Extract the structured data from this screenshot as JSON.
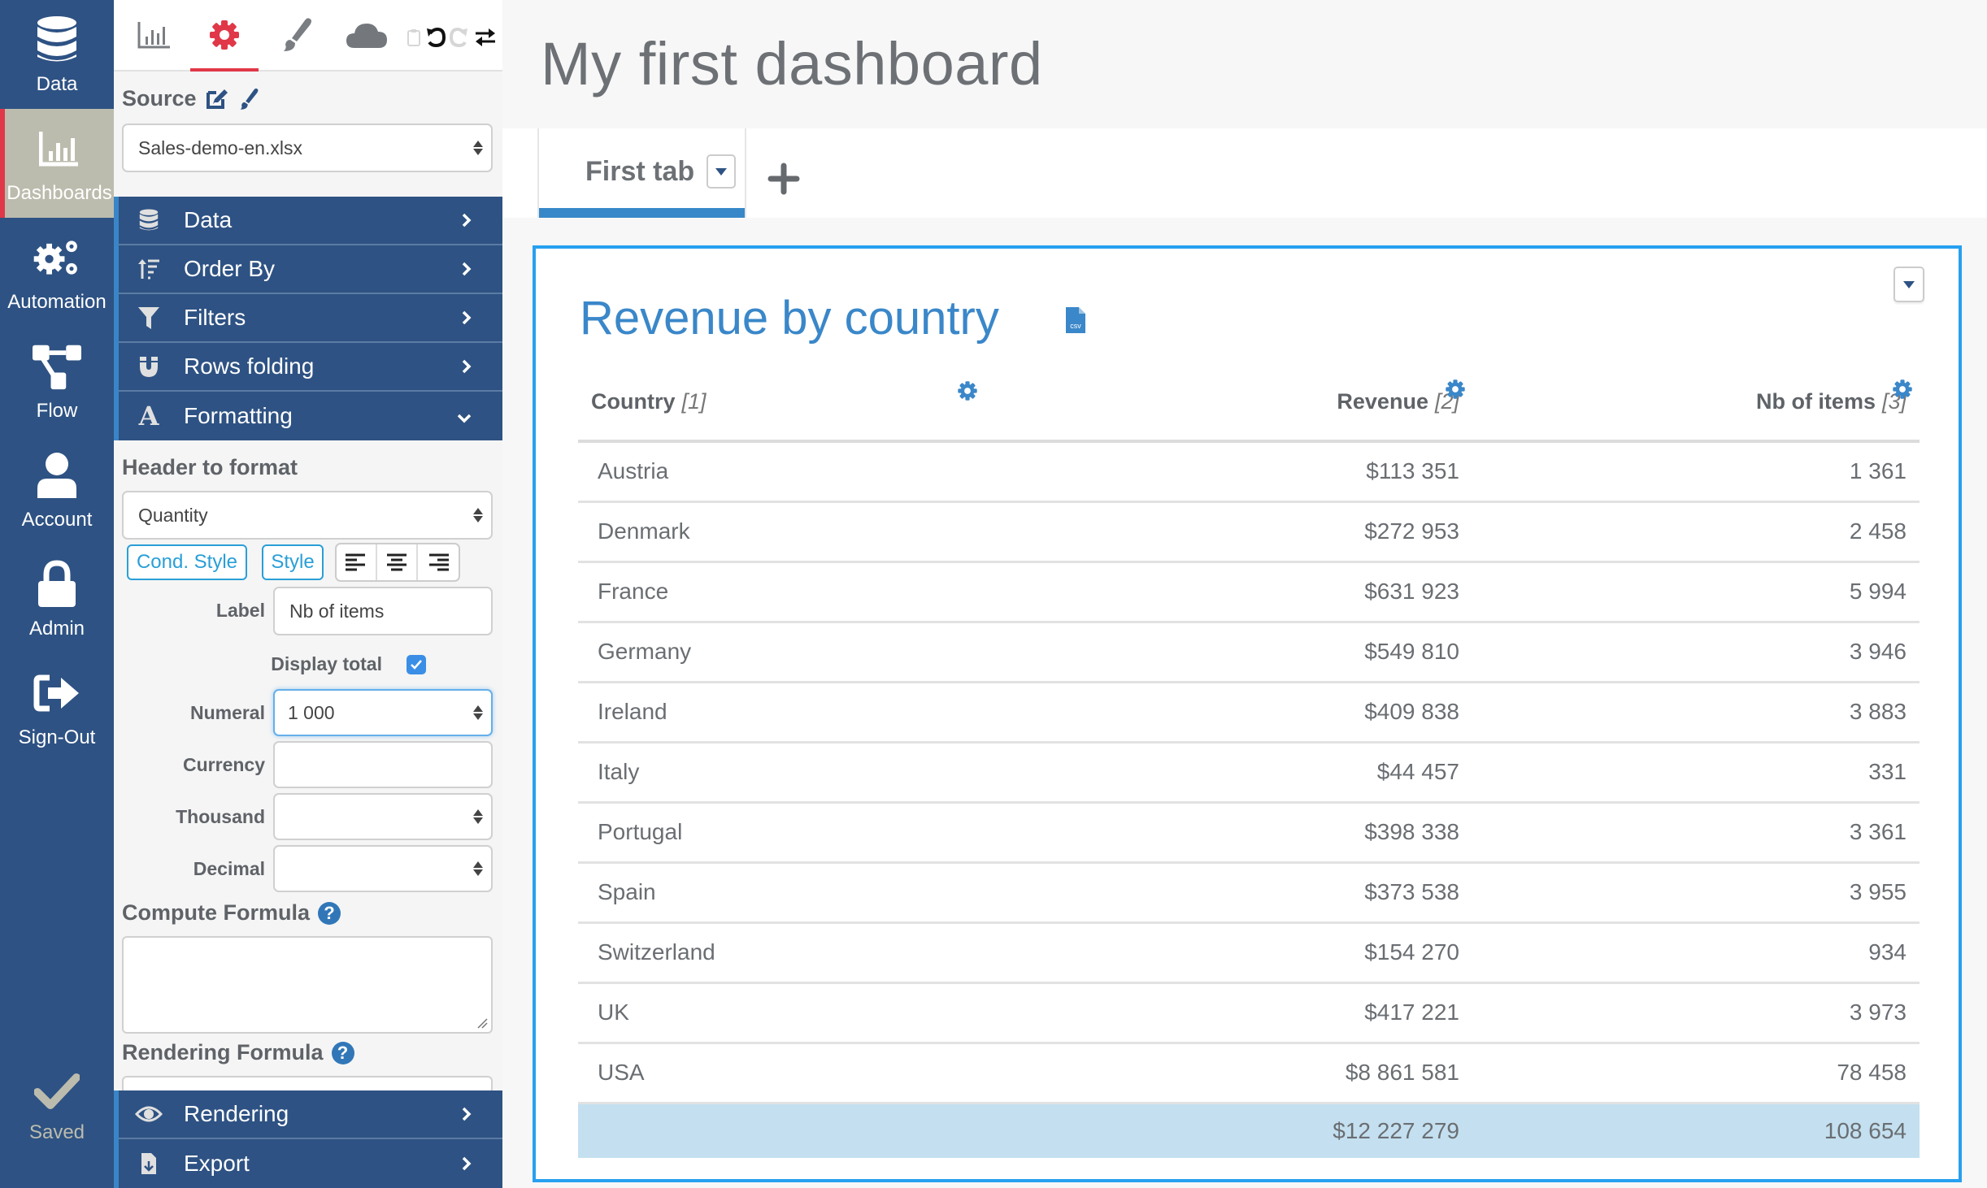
{
  "nav": {
    "items": [
      {
        "label": "Data",
        "icon": "database-icon"
      },
      {
        "label": "Dashboards",
        "icon": "bar-chart-icon",
        "active": true
      },
      {
        "label": "Automation",
        "icon": "gears-icon"
      },
      {
        "label": "Flow",
        "icon": "flow-icon"
      },
      {
        "label": "Account",
        "icon": "user-icon"
      },
      {
        "label": "Admin",
        "icon": "lock-icon"
      },
      {
        "label": "Sign-Out",
        "icon": "sign-out-icon"
      }
    ],
    "saved_label": "Saved"
  },
  "toolbar": {
    "tabs": [
      "chart",
      "settings",
      "style",
      "cloud"
    ],
    "active_tab": "settings",
    "actions": [
      "paste",
      "undo",
      "redo",
      "swap"
    ]
  },
  "panel": {
    "source_label": "Source",
    "source_value": "Sales-demo-en.xlsx",
    "accordion_top": [
      {
        "label": "Data",
        "icon": "database-icon",
        "state": "collapsed"
      },
      {
        "label": "Order By",
        "icon": "sort-icon",
        "state": "collapsed"
      },
      {
        "label": "Filters",
        "icon": "filter-icon",
        "state": "collapsed"
      },
      {
        "label": "Rows folding",
        "icon": "magnet-icon",
        "state": "collapsed"
      },
      {
        "label": "Formatting",
        "icon": "font-icon",
        "state": "expanded"
      }
    ],
    "formatting": {
      "header_to_format_label": "Header to format",
      "header_to_format_value": "Quantity",
      "cond_style_label": "Cond. Style",
      "style_label": "Style",
      "label_label": "Label",
      "label_value": "Nb of items",
      "display_total_label": "Display total",
      "display_total_checked": true,
      "numeral_label": "Numeral",
      "numeral_value": "1 000",
      "currency_label": "Currency",
      "currency_value": "",
      "thousand_label": "Thousand",
      "thousand_value": "",
      "decimal_label": "Decimal",
      "decimal_value": "",
      "compute_formula_label": "Compute Formula",
      "compute_formula_value": "",
      "rendering_formula_label": "Rendering Formula",
      "help_glyph": "?"
    },
    "accordion_bottom": [
      {
        "label": "Rendering",
        "icon": "eye-icon",
        "state": "collapsed"
      },
      {
        "label": "Export",
        "icon": "file-export-icon",
        "state": "collapsed"
      }
    ]
  },
  "main": {
    "title": "My first dashboard",
    "tabs": [
      {
        "label": "First tab",
        "active": true
      }
    ],
    "widget": {
      "title": "Revenue by country",
      "csv_label": "csv",
      "columns": [
        {
          "label": "Country",
          "index": "[1]",
          "align": "left"
        },
        {
          "label": "Revenue",
          "index": "[2]",
          "align": "right"
        },
        {
          "label": "Nb of items",
          "index": "[3]",
          "align": "right"
        }
      ],
      "rows": [
        [
          "Austria",
          "$113 351",
          "1 361"
        ],
        [
          "Denmark",
          "$272 953",
          "2 458"
        ],
        [
          "France",
          "$631 923",
          "5 994"
        ],
        [
          "Germany",
          "$549 810",
          "3 946"
        ],
        [
          "Ireland",
          "$409 838",
          "3 883"
        ],
        [
          "Italy",
          "$44 457",
          "331"
        ],
        [
          "Portugal",
          "$398 338",
          "3 361"
        ],
        [
          "Spain",
          "$373 538",
          "3 955"
        ],
        [
          "Switzerland",
          "$154 270",
          "934"
        ],
        [
          "UK",
          "$417 221",
          "3 973"
        ],
        [
          "USA",
          "$8 861 581",
          "78 458"
        ]
      ],
      "total": [
        "",
        "$12 227 279",
        "108 654"
      ]
    }
  },
  "colors": {
    "nav_bg": "#2e5283",
    "nav_active_bg": "#bcbcae",
    "active_marker": "#e03848",
    "widget_border": "#27a0f0",
    "title_blue": "#3a87c9",
    "total_row_bg": "#c4e0f0"
  }
}
